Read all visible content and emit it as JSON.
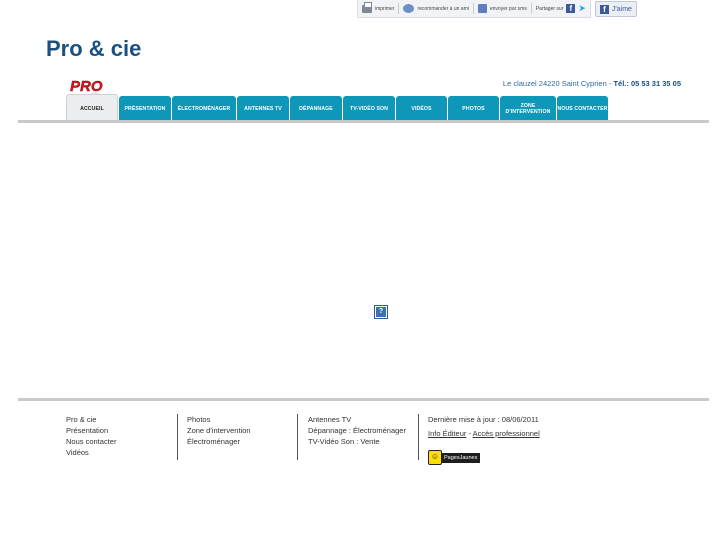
{
  "share": {
    "print_label": "imprimer",
    "recommend_label": "recommander à un ami",
    "send_label": "envoyer par sms",
    "share_on_label": "Partager sur",
    "like_label": "J'aime",
    "icons": [
      "printer-icon",
      "recommend-icon",
      "mail-icon",
      "facebook-icon",
      "twitter-icon"
    ]
  },
  "site": {
    "title": "Pro & cie",
    "logo_text": "PRO",
    "address": "Le clauzel 24220 Saint Cyprien",
    "separator": "-",
    "tel_label": "Tél.: 05 53 31 35 05"
  },
  "nav": {
    "tabs": [
      {
        "label": "ACCUEIL"
      },
      {
        "label": "PRÉSENTATION"
      },
      {
        "label": "ÉLECTROMÉNAGER"
      },
      {
        "label": "ANTENNES TV"
      },
      {
        "label": "DÉPANNAGE"
      },
      {
        "label": "TV-VIDÉO SON"
      },
      {
        "label": "VIDÉOS"
      },
      {
        "label": "PHOTOS"
      },
      {
        "label": "ZONE D'INTERVENTION"
      },
      {
        "label": "NOUS CONTACTER"
      }
    ]
  },
  "main": {
    "broken_image_glyph": "?"
  },
  "footer": {
    "col1": [
      "Pro & cie",
      "Présentation",
      "Nous contacter",
      "Vidéos"
    ],
    "col2": [
      "Photos",
      "Zone d'intervention",
      "Électroménager"
    ],
    "col3": [
      "Antennes TV",
      "Dépannage : Électroménager",
      "TV-Vidéo Son : Vente"
    ],
    "last_update": "Dernière mise à jour : 08/06/2011",
    "info_editeur": "Info Éditeur",
    "dash": "-",
    "acces_pro": "Accès professionnel",
    "pages_jaunes": "PagesJaunes"
  },
  "colors": {
    "brand_blue": "#1a5180",
    "tab_teal": "#0f97b9",
    "logo_red": "#d7141a"
  }
}
